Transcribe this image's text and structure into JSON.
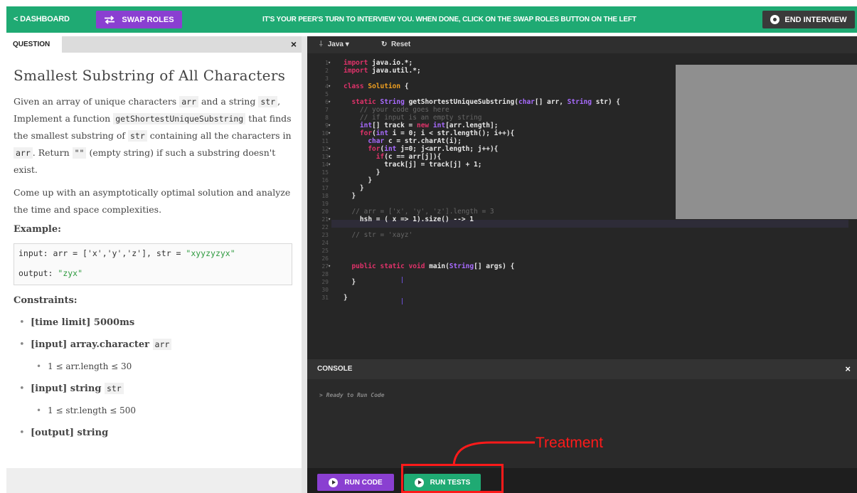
{
  "topbar": {
    "dashboard_label": "< DASHBOARD",
    "swap_label": "SWAP ROLES",
    "message": "IT'S YOUR PEER'S TURN TO INTERVIEW YOU. WHEN DONE, CLICK ON THE SWAP ROLES BUTTON ON THE LEFT",
    "end_label": "END INTERVIEW"
  },
  "question_panel": {
    "tab_label": "QUESTION",
    "close_label": "×",
    "title": "Smallest Substring of All Characters",
    "desc_1": "Given an array of unique characters ",
    "arr": "arr",
    "desc_2": " and a string ",
    "str": "str",
    "desc_3": ", Implement a function ",
    "func": "getShortestUniqueSubstring",
    "desc_4": " that finds the smallest substring of ",
    "desc_5": " containing all the characters in ",
    "desc_6": ". Return ",
    "empty": "\"\"",
    "desc_7": " (empty string) if such a substring doesn't exist.",
    "desc_8": "Come up with an asymptotically optimal solution and analyze the time and space complexities.",
    "example_heading": "Example:",
    "example_input_prefix": "input:  arr = ['x','y','z'], str = ",
    "example_input_str": "\"xyyzyzyx\"",
    "example_output_prefix": "output: ",
    "example_output_str": "\"zyx\"",
    "constraints_heading": "Constraints:",
    "c1": "[time limit] 5000ms",
    "c2_prefix": "[input] array.character ",
    "c2_sub": "1 ≤ arr.length ≤ 30",
    "c3_prefix": "[input] string ",
    "c3_sub": "1 ≤ str.length ≤ 500",
    "c4": "[output] string"
  },
  "editor": {
    "language": "Java",
    "language_caret": "▾",
    "reset_label": "Reset",
    "code_lines": [
      {
        "n": "1",
        "fold": "▾",
        "t": "import java.io.*;"
      },
      {
        "n": "2",
        "fold": "",
        "t": "import java.util.*;"
      },
      {
        "n": "3",
        "fold": "",
        "t": ""
      },
      {
        "n": "4",
        "fold": "▾",
        "t": "class Solution {"
      },
      {
        "n": "5",
        "fold": "",
        "t": ""
      },
      {
        "n": "6",
        "fold": "▾",
        "t": "  static String getShortestUniqueSubstring(char[] arr, String str) {"
      },
      {
        "n": "7",
        "fold": "",
        "t": "    // your code goes here"
      },
      {
        "n": "8",
        "fold": "",
        "t": "    // if input is an empty string"
      },
      {
        "n": "9",
        "fold": "▾",
        "t": "    int[] track = new int[arr.length];"
      },
      {
        "n": "10",
        "fold": "▾",
        "t": "    for(int i = 0; i < str.length(); i++){"
      },
      {
        "n": "11",
        "fold": "",
        "t": "      char c = str.charAt(i);"
      },
      {
        "n": "12",
        "fold": "▾",
        "t": "      for(int j=0; j<arr.length; j++){"
      },
      {
        "n": "13",
        "fold": "▾",
        "t": "        if(c == arr[j]){"
      },
      {
        "n": "14",
        "fold": "▾",
        "t": "          track[j] = track[j] + 1;"
      },
      {
        "n": "15",
        "fold": "",
        "t": "        }"
      },
      {
        "n": "16",
        "fold": "",
        "t": "      }"
      },
      {
        "n": "17",
        "fold": "",
        "t": "    }"
      },
      {
        "n": "18",
        "fold": "",
        "t": "  }"
      },
      {
        "n": "19",
        "fold": "",
        "t": ""
      },
      {
        "n": "20",
        "fold": "",
        "t": "  // arr = ['x', 'y', 'z'].length = 3"
      },
      {
        "n": "21",
        "fold": "▾",
        "t": "    hsh = ( x => 1).size() --> 1"
      },
      {
        "n": "22",
        "fold": "",
        "t": ""
      },
      {
        "n": "23",
        "fold": "",
        "t": "  // str = 'xayz'"
      },
      {
        "n": "24",
        "fold": "",
        "t": ""
      },
      {
        "n": "25",
        "fold": "",
        "t": ""
      },
      {
        "n": "26",
        "fold": "",
        "t": ""
      },
      {
        "n": "27",
        "fold": "▾",
        "t": "  public static void main(String[] args) {"
      },
      {
        "n": "28",
        "fold": "",
        "t": ""
      },
      {
        "n": "29",
        "fold": "",
        "t": "  }"
      },
      {
        "n": "30",
        "fold": "",
        "t": ""
      },
      {
        "n": "31",
        "fold": "",
        "t": "}"
      }
    ]
  },
  "console": {
    "title": "CONSOLE",
    "close_label": "×",
    "message": "> Ready to Run Code"
  },
  "run_bar": {
    "run_code_label": "RUN CODE",
    "run_tests_label": "RUN TESTS"
  },
  "annotation": {
    "label": "Treatment",
    "color": "#ff1a1a"
  },
  "colors": {
    "brand_green": "#1faa73",
    "purple": "#8a3fd1",
    "editor_bg": "#262626"
  }
}
